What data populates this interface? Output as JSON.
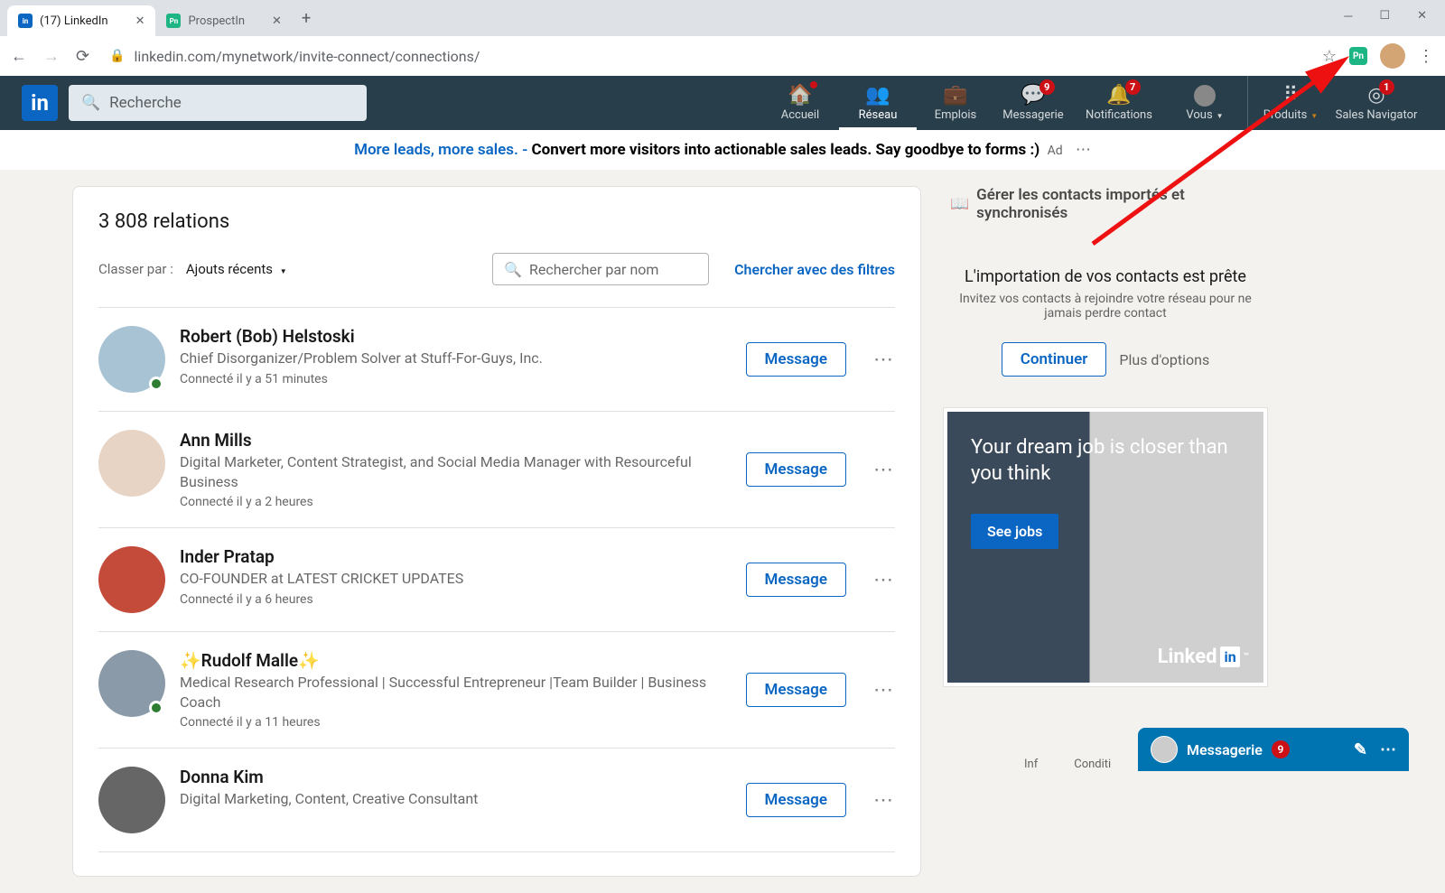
{
  "browser": {
    "tabs": [
      {
        "title": "(17) LinkedIn",
        "favicon_bg": "#0a66c2",
        "favicon_txt": "in"
      },
      {
        "title": "ProspectIn",
        "favicon_bg": "#1db584",
        "favicon_txt": "Pn"
      }
    ],
    "url": "linkedin.com/mynetwork/invite-connect/connections/"
  },
  "header": {
    "search_placeholder": "Recherche",
    "nav": [
      {
        "id": "home",
        "label": "Accueil",
        "icon": "⌂",
        "dot": true
      },
      {
        "id": "network",
        "label": "Réseau",
        "icon": "👥",
        "active": true
      },
      {
        "id": "jobs",
        "label": "Emplois",
        "icon": "💼"
      },
      {
        "id": "msg",
        "label": "Messagerie",
        "icon": "💬",
        "badge": "9"
      },
      {
        "id": "notif",
        "label": "Notifications",
        "icon": "🔔",
        "badge": "7"
      },
      {
        "id": "me",
        "label": "Vous",
        "avatar": true,
        "caret": true
      },
      {
        "id": "divider"
      },
      {
        "id": "work",
        "label": "Produits",
        "icon": "⠿",
        "caret": true,
        "caret_color": "#c37d16"
      },
      {
        "id": "sales",
        "label": "Sales Navigator",
        "icon": "◎",
        "badge": "1"
      }
    ]
  },
  "ad_top": {
    "link_text": "More leads, more sales. -",
    "body_text": " Convert more visitors into actionable sales leads. Say goodbye to forms :)",
    "ad_label": "Ad"
  },
  "main": {
    "count_label": "3 808 relations",
    "sort_label": "Classer par :",
    "sort_value": "Ajouts récents",
    "search_placeholder": "Rechercher par nom",
    "filter_link": "Chercher avec des filtres",
    "message_label": "Message",
    "connections": [
      {
        "name": "Robert (Bob) Helstoski",
        "title": "Chief Disorganizer/Problem Solver at Stuff-For-Guys, Inc.",
        "meta": "Connecté il y a 51 minutes",
        "presence": true,
        "bg": "#a8c4d4"
      },
      {
        "name": "Ann Mills",
        "title": "Digital Marketer, Content Strategist, and Social Media Manager with Resourceful Business",
        "meta": "Connecté il y a 2 heures",
        "bg": "#e8d4c4"
      },
      {
        "name": "Inder Pratap",
        "title": "CO-FOUNDER at LATEST CRICKET UPDATES",
        "meta": "Connecté il y a 6 heures",
        "bg": "#c44a3a"
      },
      {
        "name": "✨Rudolf Malle✨",
        "title": "Medical Research Professional | Successful Entrepreneur |Team Builder | Business Coach",
        "meta": "Connecté il y a 11 heures",
        "presence": true,
        "bg": "#8a9aa8"
      },
      {
        "name": "Donna Kim",
        "title": "Digital Marketing, Content, Creative Consultant",
        "meta": "",
        "bg": "#666"
      }
    ]
  },
  "right": {
    "manage_label": "Gérer les contacts importés et synchronisés",
    "import_title": "L'importation de vos contacts est prête",
    "import_sub": "Invitez vos contacts à rejoindre votre réseau pour ne jamais perdre contact",
    "continue_label": "Continuer",
    "more_label": "Plus d'options",
    "ad": {
      "text": "Your dream job is closer than you think",
      "button": "See jobs",
      "brand": "Linked"
    },
    "footer": {
      "a": "Inf",
      "b": "Conditi"
    }
  },
  "dock": {
    "label": "Messagerie",
    "badge": "9"
  }
}
